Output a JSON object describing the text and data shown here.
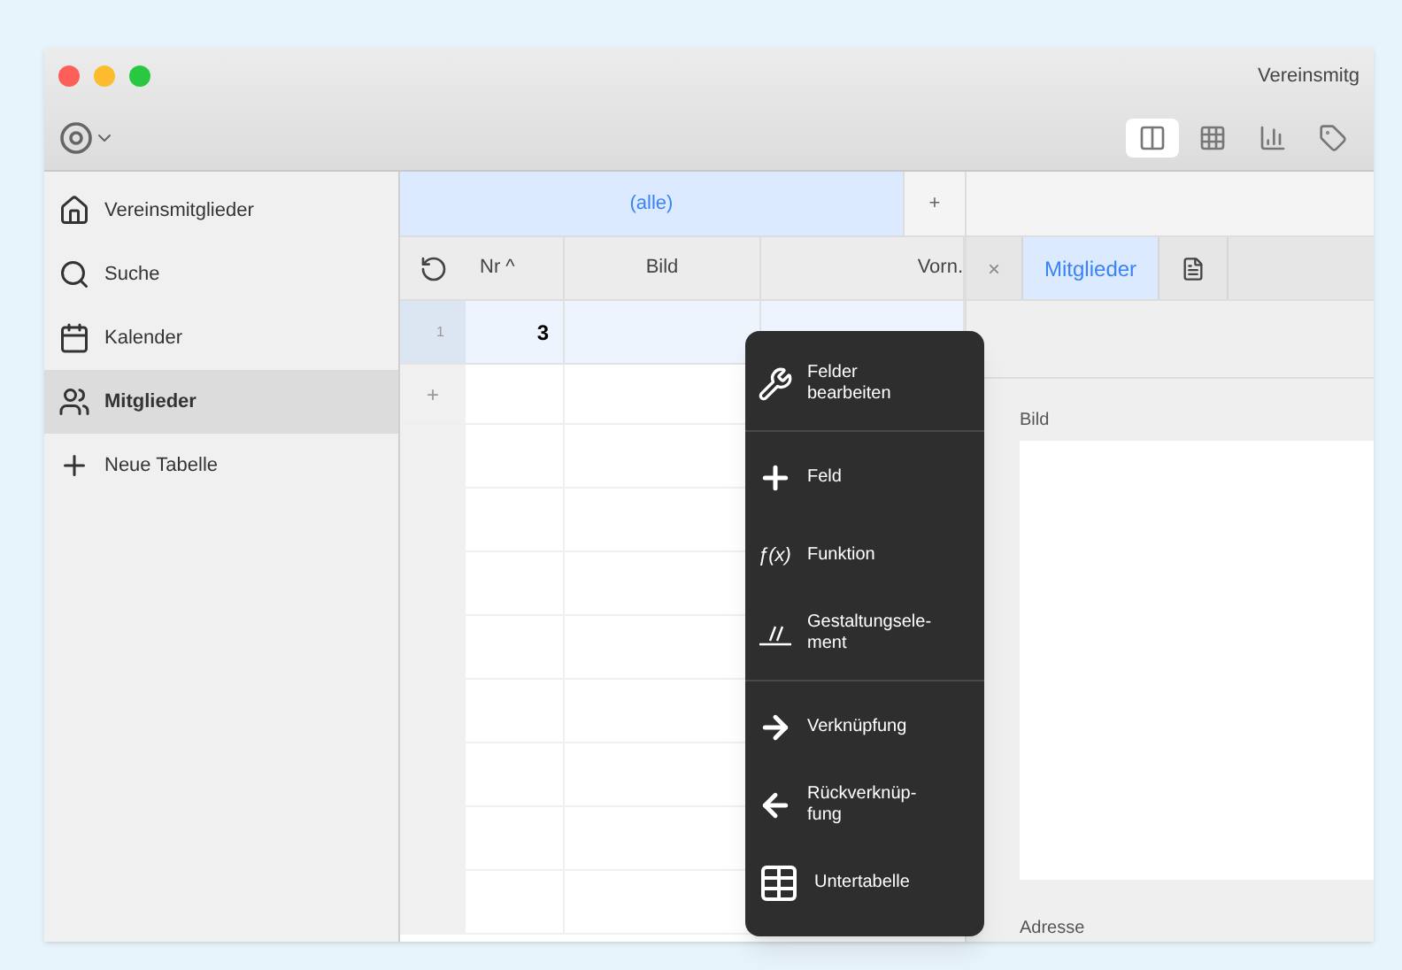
{
  "window": {
    "title": "Vereinsmitg"
  },
  "toolbar": {
    "view_buttons": [
      {
        "kind": "form",
        "selected": true
      },
      {
        "kind": "grid",
        "selected": false
      },
      {
        "kind": "chart",
        "selected": false
      },
      {
        "kind": "label",
        "selected": false
      }
    ]
  },
  "sidebar": {
    "items": [
      {
        "kind": "home",
        "label": "Vereinsmitglieder",
        "selected": false
      },
      {
        "kind": "search",
        "label": "Suche",
        "selected": false
      },
      {
        "kind": "calendar",
        "label": "Kalender",
        "selected": false
      },
      {
        "kind": "members",
        "label": "Mitglieder",
        "selected": true
      },
      {
        "kind": "add",
        "label": "Neue Tabelle",
        "selected": false
      }
    ]
  },
  "filter_bar": {
    "tab": "(alle)",
    "add": "+"
  },
  "table": {
    "columns": [
      "Nr ^",
      "Bild",
      "Vorn."
    ],
    "rows": [
      {
        "index": "1",
        "cells": [
          "3",
          "",
          ""
        ]
      }
    ],
    "add_row": "+"
  },
  "detail": {
    "tabs": [
      {
        "kind": "close",
        "label": "×",
        "selected": false
      },
      {
        "kind": "text",
        "label": "Mitglieder",
        "selected": true
      },
      {
        "kind": "doc",
        "selected": false
      }
    ],
    "fields": [
      {
        "label": "Bild"
      },
      {
        "label": "Adresse"
      }
    ]
  },
  "context_menu": {
    "sections": [
      [
        {
          "kind": "wrench",
          "label": "Felder bearbeiten"
        }
      ],
      [
        {
          "kind": "plus",
          "label": "Feld"
        },
        {
          "kind": "glyph",
          "icon_text": "ƒ(x)",
          "label": "Funktion"
        },
        {
          "kind": "design",
          "label": "Gestaltungsele-ment"
        }
      ],
      [
        {
          "kind": "arrow-right",
          "label": "Verknüpfung"
        },
        {
          "kind": "arrow-left",
          "label": "Rückverknüp-fung"
        },
        {
          "kind": "table",
          "label": "Untertabelle"
        }
      ]
    ]
  }
}
